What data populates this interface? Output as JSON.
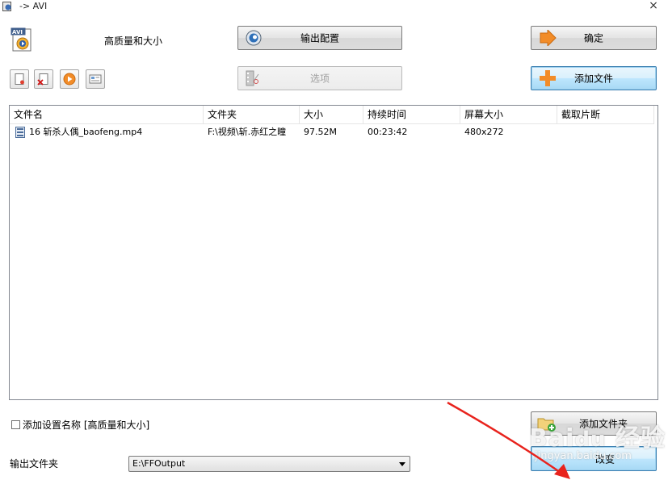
{
  "window": {
    "title": "-> AVI",
    "close_glyph": "×"
  },
  "profile": {
    "name": "高质量和大小",
    "icon_text": "AVI"
  },
  "buttons": {
    "output_config": "输出配置",
    "ok": "确定",
    "options": "选项",
    "add_file": "添加文件",
    "add_folder": "添加文件夹",
    "change": "改变"
  },
  "toolbar": {
    "items": [
      "new-doc-icon",
      "delete-doc-icon",
      "play-icon",
      "info-card-icon"
    ]
  },
  "file_list": {
    "columns": [
      "文件名",
      "文件夹",
      "大小",
      "持续时间",
      "屏幕大小",
      "截取片断"
    ],
    "rows": [
      {
        "filename": "16 斩杀人偶_baofeng.mp4",
        "folder": "F:\\视频\\斩.赤红之瞳",
        "size": "97.52M",
        "duration": "00:23:42",
        "screen_size": "480x272",
        "clip": ""
      }
    ]
  },
  "add_setting_name": {
    "label": "添加设置名称 [高质量和大小]",
    "checked": false
  },
  "output_folder": {
    "label": "输出文件夹",
    "value": "E:\\FFOutput"
  },
  "colors": {
    "accent_orange": "#f28c28",
    "annotation_red": "#e8231d",
    "focus_blue": "#3c7fb1"
  }
}
